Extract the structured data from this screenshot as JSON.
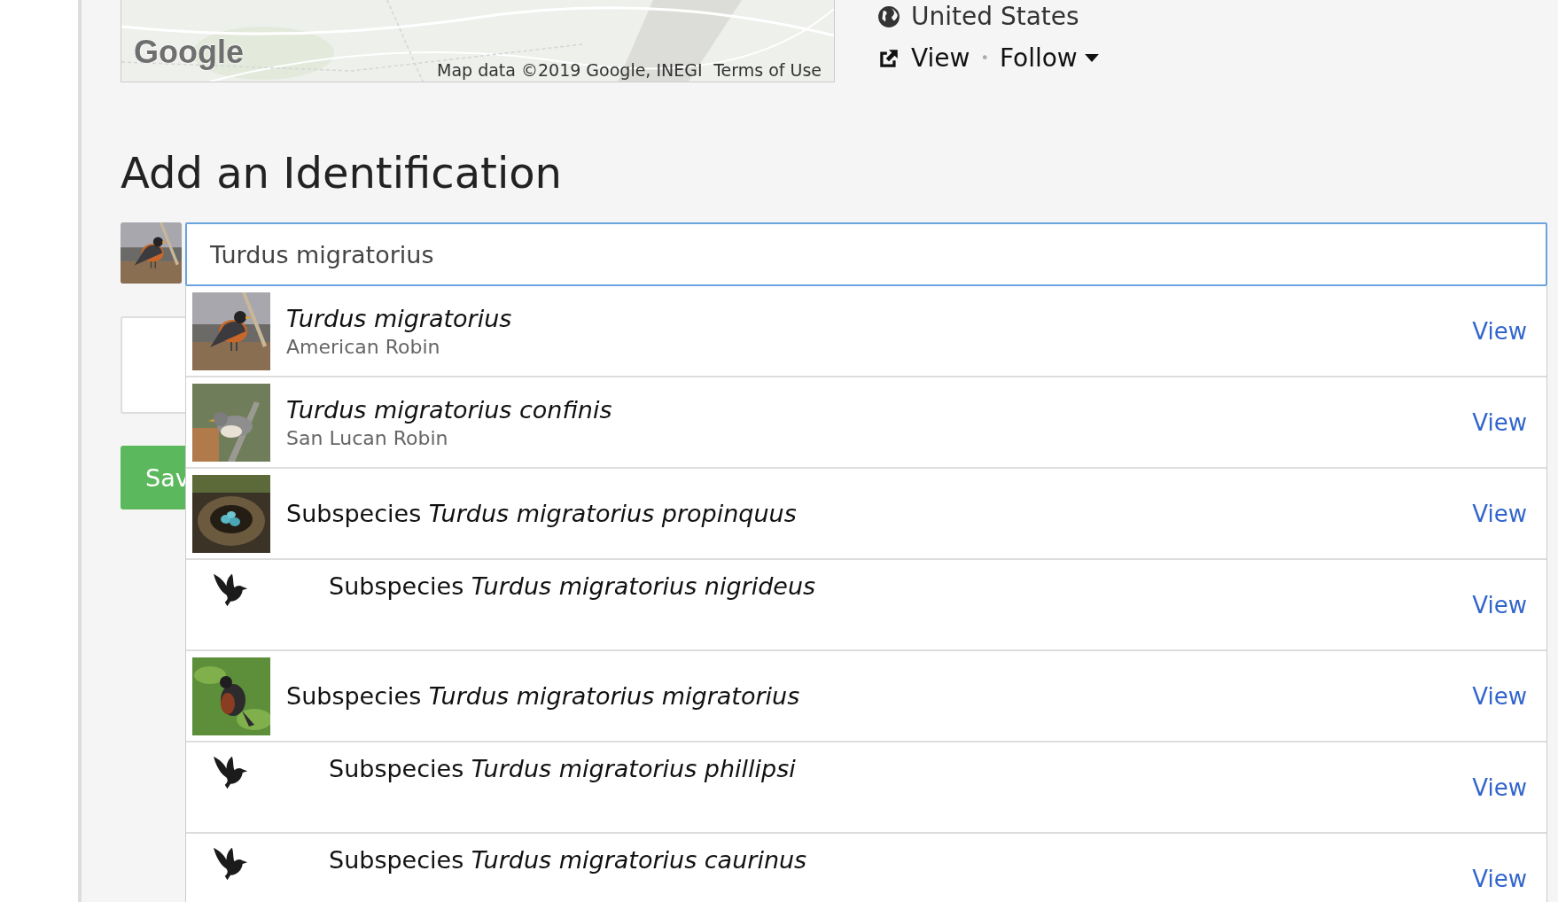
{
  "map": {
    "logo": "Google",
    "attribution": "Map data ©2019 Google, INEGI",
    "terms": "Terms of Use"
  },
  "place": "United States",
  "actions": {
    "view": "View",
    "separator": "•",
    "follow": "Follow"
  },
  "heading": "Add an Identification",
  "search": {
    "value": "Turdus migratorius"
  },
  "save_button": "Sav",
  "suggestions": [
    {
      "kind": "taxon",
      "photo": true,
      "name": "Turdus migratorius",
      "common_name": "American Robin",
      "link": "View"
    },
    {
      "kind": "taxon",
      "photo": true,
      "name": "Turdus migratorius confinis",
      "common_name": "San Lucan Robin",
      "link": "View"
    },
    {
      "kind": "subspecies",
      "photo": true,
      "label": "Subspecies *Turdus migratorius propinquus*",
      "link": "View"
    },
    {
      "kind": "subspecies",
      "photo": false,
      "label": "Subspecies *Turdus migratorius nigrideus*",
      "link": "View"
    },
    {
      "kind": "subspecies",
      "photo": true,
      "label": "Subspecies *Turdus migratorius migratorius*",
      "link": "View"
    },
    {
      "kind": "subspecies",
      "photo": false,
      "label": "Subspecies *Turdus migratorius phillipsi*",
      "link": "View"
    },
    {
      "kind": "subspecies",
      "photo": false,
      "label": "Subspecies *Turdus migratorius caurinus*",
      "link": "View"
    }
  ]
}
